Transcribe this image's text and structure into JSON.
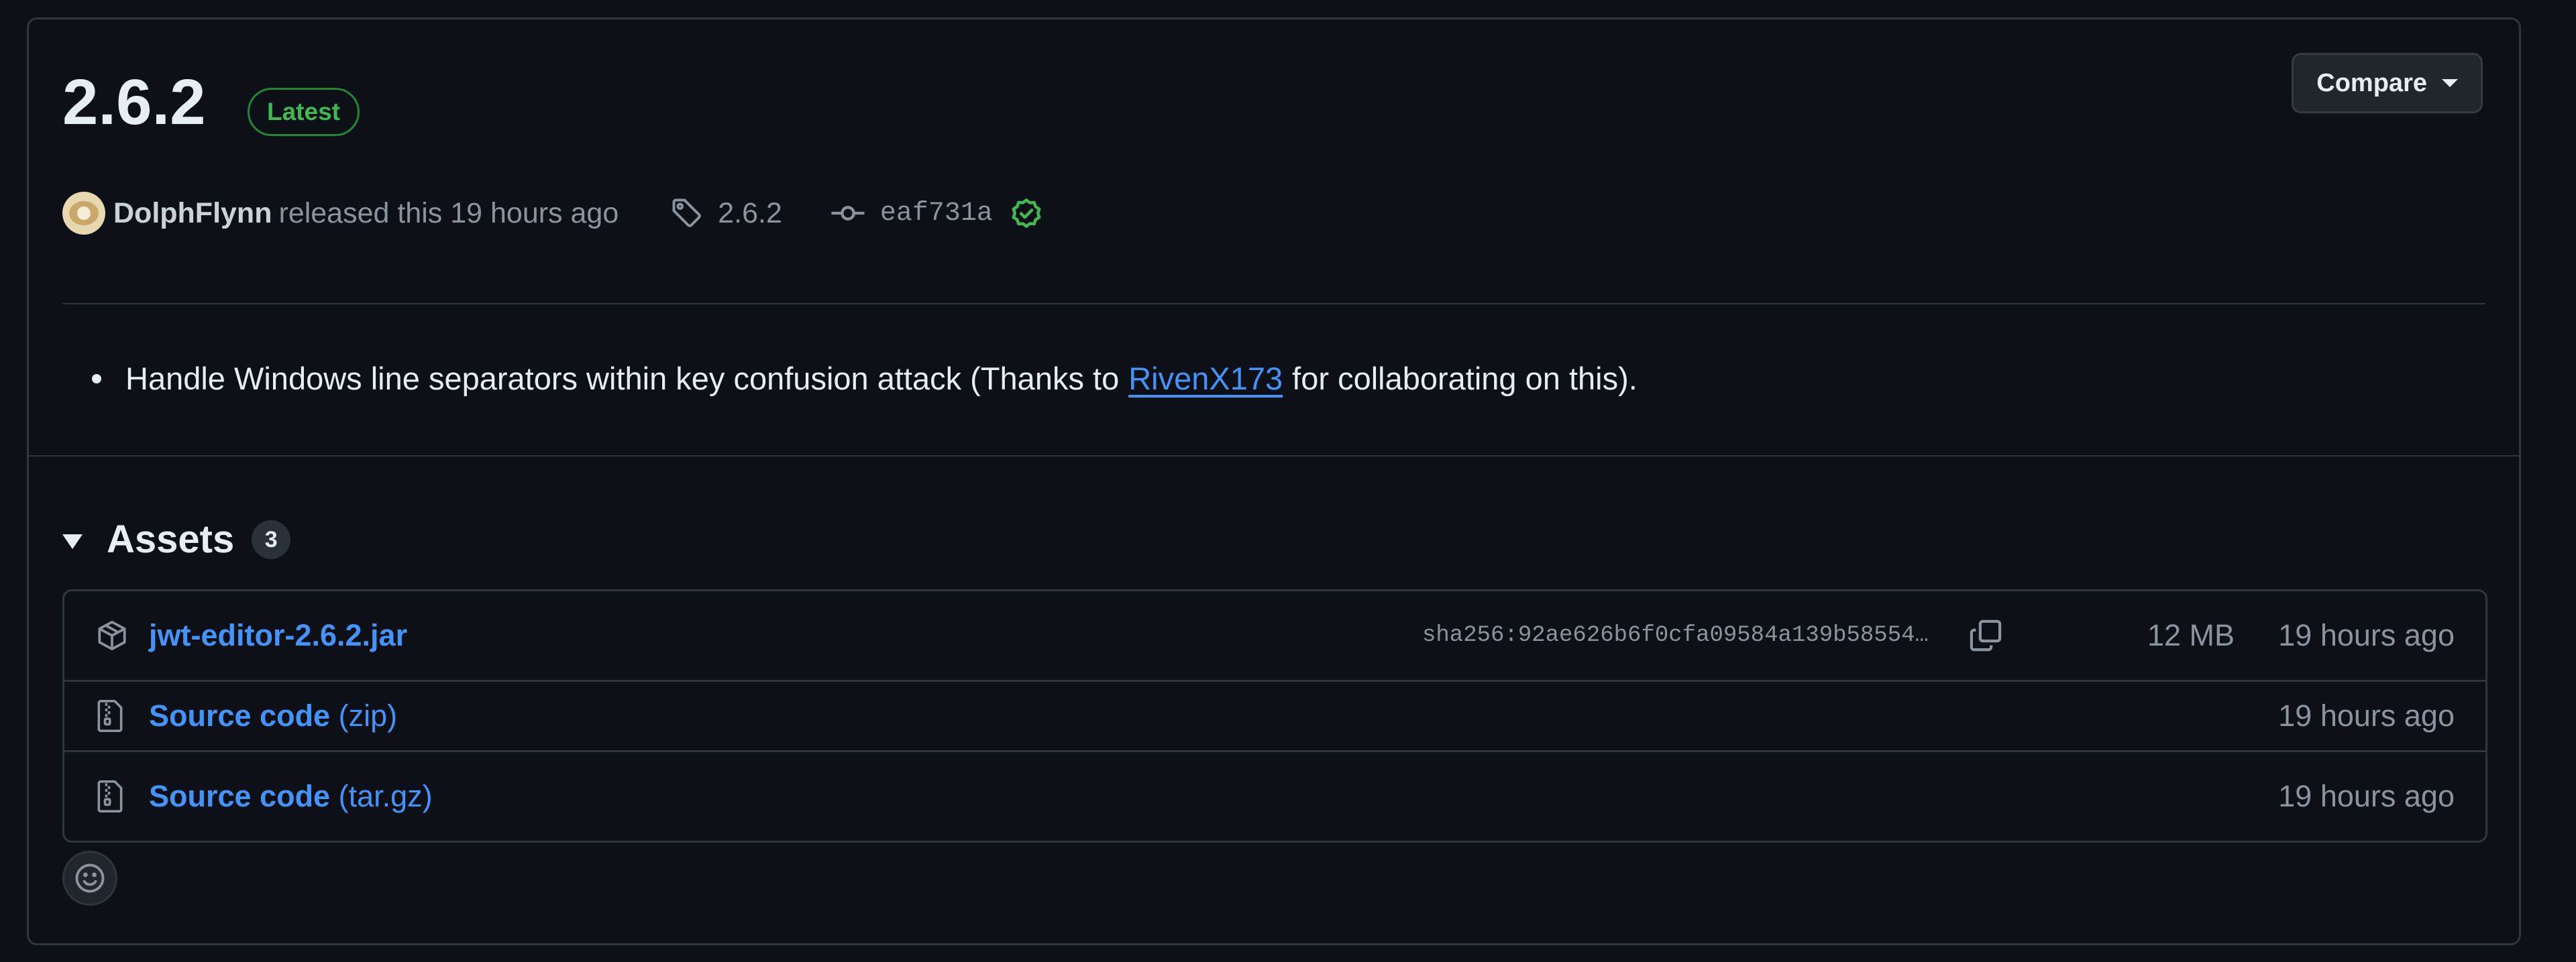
{
  "release": {
    "version": "2.6.2",
    "badge": "Latest",
    "compare_label": "Compare",
    "author": "DolphFlynn",
    "released_text": "released this 19 hours ago",
    "tag": "2.6.2",
    "commit": "eaf731a",
    "verified_icon": "check-circle-icon",
    "tag_icon": "tag-icon",
    "commit_icon": "git-commit-icon"
  },
  "notes": {
    "before": "Handle Windows line separators within key confusion attack (Thanks to",
    "link": "RivenX173",
    "after": "for collaborating on this)."
  },
  "assets": {
    "title": "Assets",
    "count": "3",
    "rows": [
      {
        "icon": "package-icon",
        "name": "jwt-editor-2.6.2.jar",
        "sha": "sha256:92ae626b6f0cfa09584a139b58554…",
        "size": "12 MB",
        "time": "19 hours ago"
      },
      {
        "icon": "file-zip-icon",
        "name": "Source code",
        "suffix": "(zip)",
        "time": "19 hours ago"
      },
      {
        "icon": "file-zip-icon",
        "name": "Source code",
        "suffix": "(tar.gz)",
        "time": "19 hours ago"
      }
    ]
  },
  "colors": {
    "background": "#0d1117",
    "border": "#30363d",
    "link": "#4493f8",
    "success": "#3fb950",
    "muted": "#8b949e",
    "text": "#e6edf3"
  }
}
